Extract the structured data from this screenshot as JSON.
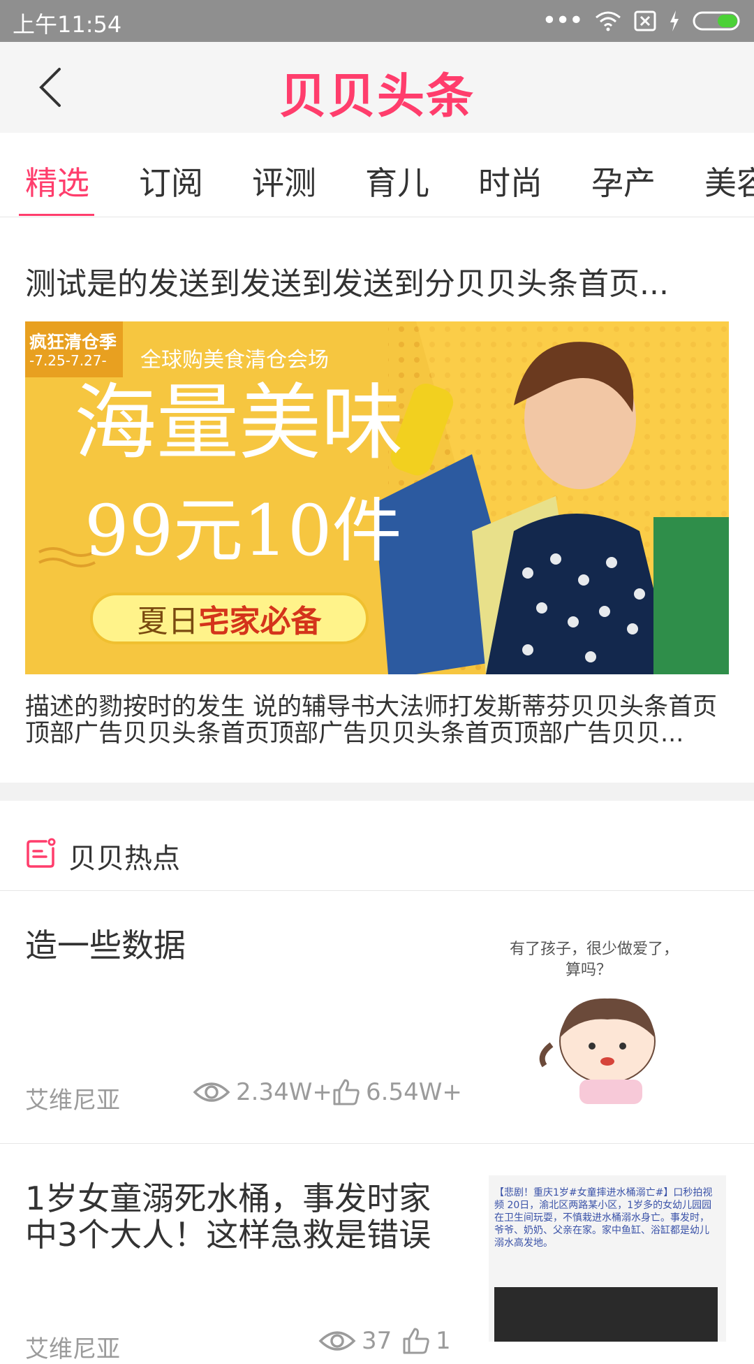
{
  "status_bar": {
    "time": "上午11:54"
  },
  "header": {
    "title": "贝贝头条"
  },
  "tabs": [
    {
      "label": "精选"
    },
    {
      "label": "订阅"
    },
    {
      "label": "评测"
    },
    {
      "label": "育儿"
    },
    {
      "label": "时尚"
    },
    {
      "label": "孕产"
    },
    {
      "label": "美容"
    }
  ],
  "feature": {
    "title": "测试是的发送到发送到发送到分贝贝头条首页...",
    "banner": {
      "tag_line1": "疯狂清仓季",
      "tag_line2": "-7.25-7.27-",
      "subtitle": "全球购美食清仓会场",
      "headline": "海量美味",
      "price": "99元10件",
      "pill_plain": "夏日",
      "pill_bold": "宅家必备"
    },
    "description": "描述的勠按时的发生 说的辅导书大法师打发斯蒂芬贝贝头条首页顶部广告贝贝头条首页顶部广告贝贝头条首页顶部广告贝贝..."
  },
  "hot_section": {
    "title": "贝贝热点",
    "items": [
      {
        "title": "造一些数据",
        "author": "艾维尼亚",
        "views": "2.34W+",
        "likes": "6.54W+",
        "thumb_text_line1": "有了孩子，很少做爱了，",
        "thumb_text_line2": "算吗？"
      },
      {
        "title": "1岁女童溺死水桶，事发时家中3个大人！这样急救是错误",
        "author": "艾维尼亚",
        "views": "37",
        "likes": "1",
        "thumb_text": "【悲剧！重庆1岁#女童摔进水桶溺亡#】口秒拍视频 20日，渝北区两路某小区，1岁多的女幼儿园园在卫生间玩耍，不慎栽进水桶溺水身亡。事发时，爷爷、奶奶、父亲在家。家中鱼缸、浴缸都是幼儿溺水高发地。"
      }
    ]
  }
}
